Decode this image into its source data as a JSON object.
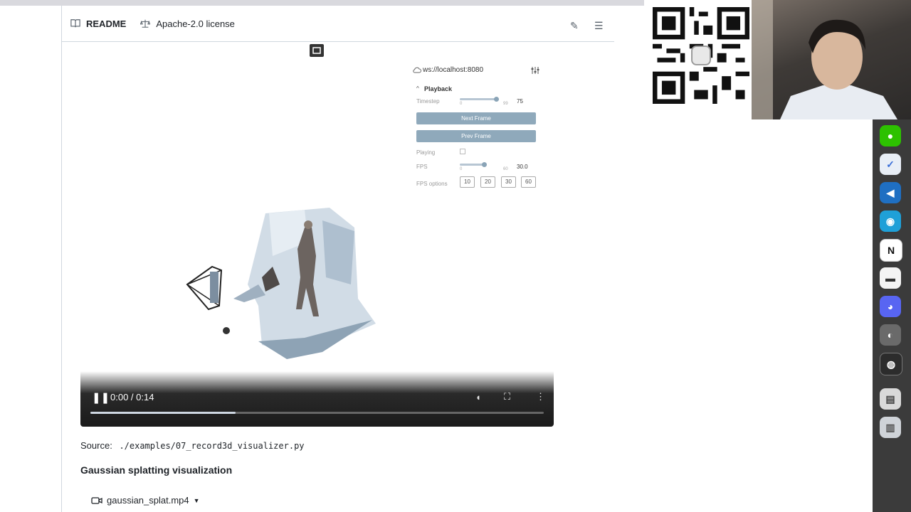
{
  "readme": {
    "tab_readme": "README",
    "tab_license": "Apache-2.0 license"
  },
  "viewer": {
    "server": "ws://localhost:8080",
    "section_title": "Playback",
    "timestep": {
      "label": "Timestep",
      "min": "0",
      "max": "99",
      "value": "75"
    },
    "next_frame": "Next Frame",
    "prev_frame": "Prev Frame",
    "playing_label": "Playing",
    "fps": {
      "label": "FPS",
      "min": "0",
      "max": "60",
      "value": "30.0"
    },
    "fps_options_label": "FPS options",
    "fps_options": [
      "10",
      "20",
      "30",
      "60"
    ]
  },
  "video_controls": {
    "time": "0:00 / 0:14",
    "progress": 0.32
  },
  "content": {
    "source_label": "Source:",
    "source_path": "./examples/07_record3d_visualizer.py",
    "section_heading": "Gaussian splatting visualization",
    "file_name": "gaussian_splat.mp4"
  },
  "colors": {
    "button": "#8fa9bb",
    "video_bar": "#1a1a1a",
    "dock": "#3b3b3b"
  }
}
